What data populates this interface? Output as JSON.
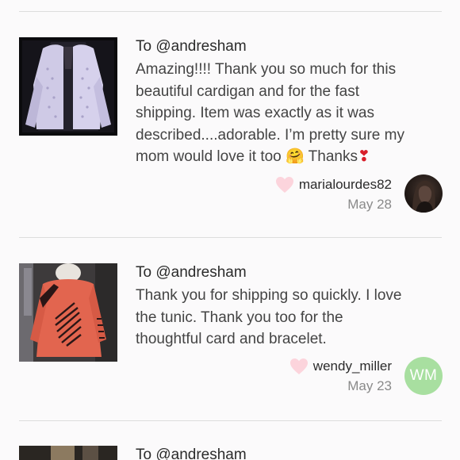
{
  "feed": {
    "notes": [
      {
        "to": "To @andresham",
        "message_lines": [
          "Amazing!!!! Thank you so much for this",
          "beautiful cardigan and for the fast",
          "shipping. Item was exactly as it was",
          "described....adorable. I’m pretty sure my",
          "mom would love it too"
        ],
        "message_tail": "Thanks",
        "emoji_hug": "🤗",
        "emoji_exclaim": "❣",
        "username": "marialourdes82",
        "date": "May 28",
        "avatar_icon": "user-photo-avatar"
      },
      {
        "to": "To @andresham",
        "message_lines": [
          "Thank you for shipping so quickly. I love",
          "the tunic. Thank you too for the",
          "thoughtful card and bracelet."
        ],
        "username": "wendy_miller",
        "date": "May 23",
        "avatar_initials": "WM"
      },
      {
        "to": "To @andresham"
      }
    ]
  },
  "colors": {
    "heart": "#fcd4dc",
    "avatar_initials_bg": "#a8dfa0",
    "divider": "#dddddd",
    "date_text": "#8a8a8a"
  }
}
